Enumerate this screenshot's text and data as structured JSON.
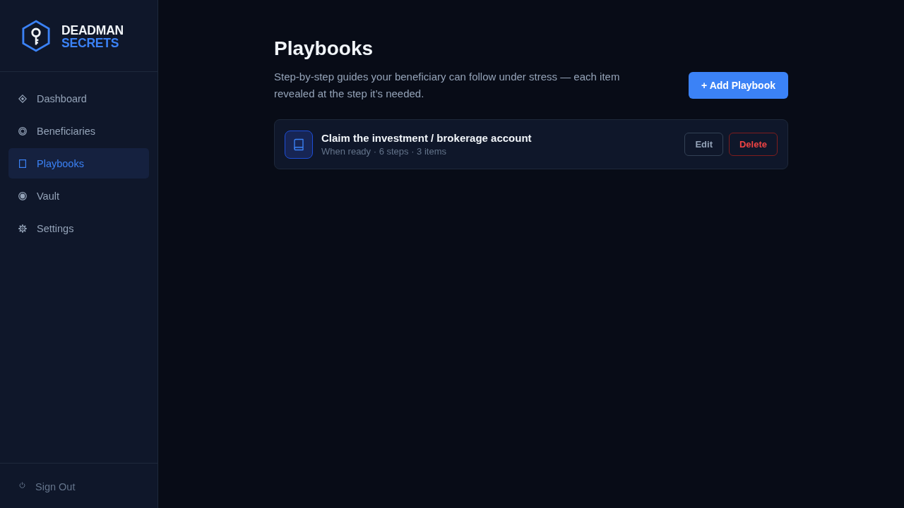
{
  "sidebar": {
    "logo": {
      "line_1": "DEADMAN",
      "line_2": "SECRETS"
    },
    "items": [
      {
        "label": "Dashboard",
        "selected": false
      },
      {
        "label": "Beneficiaries",
        "selected": false
      },
      {
        "label": "Playbooks",
        "selected": true
      },
      {
        "label": "Vault",
        "selected": false
      },
      {
        "label": "Settings",
        "selected": false
      }
    ],
    "sign_out": "Sign Out"
  },
  "page": {
    "title": "Playbooks",
    "description": "Step-by-step guides your beneficiary can follow under stress — each item revealed at the step it’s needed.",
    "add_button": "+ Add Playbook"
  },
  "playbooks": [
    {
      "title": "Claim the investment / brokerage account",
      "meta": "When ready · 6 steps · 3 items",
      "edit_button": "Edit",
      "delete_button": "Delete"
    }
  ]
}
